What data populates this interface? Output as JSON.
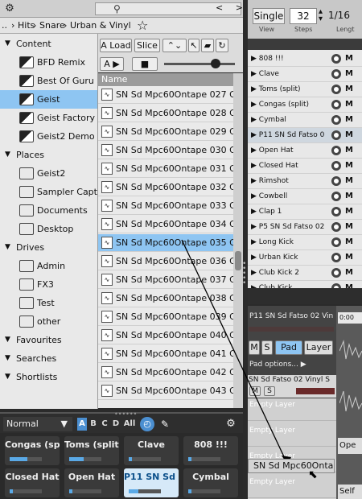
{
  "browser": {
    "breadcrumbs": [
      "..",
      "Hits",
      "Snare",
      "Urban & Vinyl"
    ],
    "nav_label": "<  >",
    "list_header": "Name",
    "toolbar": {
      "a_load": "A Load",
      "slice": "Slice",
      "a_play": "A ▶"
    },
    "tree": [
      {
        "type": "section",
        "label": "Content"
      },
      {
        "type": "item",
        "label": "BFD Remix",
        "icon": "bfd-remix-icon",
        "selected": false
      },
      {
        "type": "item",
        "label": "Best Of Guru",
        "icon": "best-of-guru-icon",
        "selected": false
      },
      {
        "type": "item",
        "label": "Geist",
        "icon": "geist-icon",
        "selected": true
      },
      {
        "type": "item",
        "label": "Geist Factory",
        "icon": "geist-factory-icon",
        "selected": false
      },
      {
        "type": "item",
        "label": "Geist2 Demo",
        "icon": "geist2-demo-icon",
        "selected": false
      },
      {
        "type": "section",
        "label": "Places"
      },
      {
        "type": "item",
        "label": "Geist2",
        "icon": "geist2-folder-icon",
        "selected": false
      },
      {
        "type": "item",
        "label": "Sampler Capt",
        "icon": "folder-icon",
        "selected": false
      },
      {
        "type": "item",
        "label": "Documents",
        "icon": "folder-icon",
        "selected": false
      },
      {
        "type": "item",
        "label": "Desktop",
        "icon": "desktop-icon",
        "selected": false
      },
      {
        "type": "section",
        "label": "Drives"
      },
      {
        "type": "item",
        "label": "Admin",
        "icon": "drive-icon",
        "selected": false
      },
      {
        "type": "item",
        "label": "FX3",
        "icon": "drive-icon",
        "selected": false
      },
      {
        "type": "item",
        "label": "Test",
        "icon": "drive-icon",
        "selected": false
      },
      {
        "type": "item",
        "label": "other",
        "icon": "drive-icon",
        "selected": false
      },
      {
        "type": "section",
        "label": "Favourites"
      },
      {
        "type": "section",
        "label": "Searches"
      },
      {
        "type": "section",
        "label": "Shortlists"
      }
    ],
    "files": [
      "SN Sd Mpc60Ontape 027 GB",
      "SN Sd Mpc60Ontape 028 GB",
      "SN Sd Mpc60Ontape 029 GB",
      "SN Sd Mpc60Ontape 030 GB",
      "SN Sd Mpc60Ontape 031 GB",
      "SN Sd Mpc60Ontape 032 GB",
      "SN Sd Mpc60Ontape 033 GB",
      "SN Sd Mpc60Ontape 034 GB",
      "SN Sd Mpc60Ontape 035 GB",
      "SN Sd Mpc60Ontape 036 GB",
      "SN Sd Mpc60Ontape 037 GB",
      "SN Sd Mpc60Ontape 038 GB",
      "SN Sd Mpc60Ontape 039 GB",
      "SN Sd Mpc60Ontape 040 GB",
      "SN Sd Mpc60Ontape 041 GB",
      "SN Sd Mpc60Ontape 042 GB",
      "SN Sd Mpc60Ontape 043 GB"
    ],
    "selected_file_index": 8
  },
  "pads": {
    "mode": "Normal",
    "banks": [
      "A",
      "B",
      "C",
      "D",
      "All"
    ],
    "row1": [
      {
        "label": "Congas (split",
        "level": 0.55
      },
      {
        "label": "Toms (split)",
        "level": 0.45
      },
      {
        "label": "Clave",
        "level": 0.1
      },
      {
        "label": "808 !!!",
        "level": 0.1
      }
    ],
    "row2": [
      {
        "label": "Closed Hat",
        "level": 0.1
      },
      {
        "label": "Open Hat",
        "level": 0.1
      },
      {
        "label": "P11 SN Sd F",
        "level": 0.3,
        "selected": true
      },
      {
        "label": "Cymbal",
        "level": 0.1
      }
    ]
  },
  "sequencer": {
    "mode": "Single",
    "steps": "32",
    "length": "1/16",
    "captions": {
      "view": "View",
      "steps": "Steps",
      "length": "Lengt"
    }
  },
  "instruments": [
    "808 !!!",
    "Clave",
    "Toms (split)",
    "Congas (split)",
    "Cymbal",
    "P11 SN Sd Fatso 0",
    "Open Hat",
    "Closed Hat",
    "Rimshot",
    "Cowbell",
    "Clap 1",
    "P5 SN Sd Fatso 02",
    "Long Kick",
    "Urban Kick",
    "Club Kick 2",
    "Club Kick"
  ],
  "instrument_selected_index": 5,
  "instrument_m_label": "M",
  "kit": {
    "title": "P11 SN Sd Fatso 02 Vin",
    "m": "M",
    "s": "S",
    "pad": "Pad",
    "layer": "Layer",
    "pad_options": "Pad options... ▶",
    "layer_name": "SN Sd Fatso 02 Vinyl S",
    "empty_layer": "Empty Layer"
  },
  "drag": {
    "label": "SN Sd Mpc60Ontape 035"
  },
  "right_edge": {
    "timecode": "0:00",
    "ope": "Ope",
    "self": "Self"
  }
}
